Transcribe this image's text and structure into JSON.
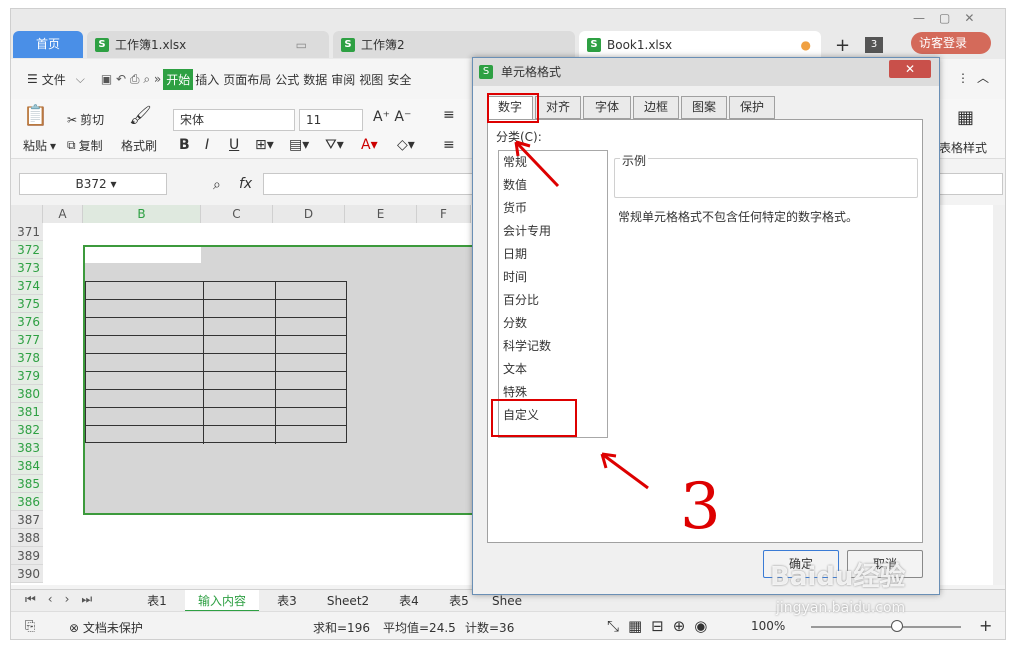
{
  "tabs": {
    "home": "首页",
    "doc1": "工作簿1.xlsx",
    "doc2": "工作簿2",
    "doc3": "Book1.xlsx",
    "count": "3",
    "login": "访客登录"
  },
  "menu": {
    "file": "文件",
    "items": [
      "开始",
      "插入",
      "页面布局",
      "公式",
      "数据",
      "审阅",
      "视图",
      "安全"
    ]
  },
  "ribbon": {
    "paste": "粘贴",
    "cut": "剪切",
    "copy": "复制",
    "format_painter": "格式刷",
    "font": "宋体",
    "size": "11",
    "bold": "B",
    "italic": "I",
    "underline": "U",
    "table_style": "表格样式"
  },
  "formula": {
    "namebox": "B372",
    "fx": "fx"
  },
  "grid": {
    "columns": [
      "A",
      "B",
      "C",
      "D",
      "E",
      "F"
    ],
    "rows": [
      "371",
      "372",
      "373",
      "374",
      "375",
      "376",
      "377",
      "378",
      "379",
      "380",
      "381",
      "382",
      "383",
      "384",
      "385",
      "386",
      "387",
      "388",
      "389",
      "390"
    ]
  },
  "sheets": [
    "表1",
    "输入内容",
    "表3",
    "Sheet2",
    "表4",
    "表5",
    "Shee"
  ],
  "status": {
    "protect": "文档未保护",
    "sum": "求和=196",
    "avg": "平均值=24.5",
    "count": "计数=36",
    "zoom": "100%"
  },
  "dialog": {
    "title": "单元格格式",
    "tabs": [
      "数字",
      "对齐",
      "字体",
      "边框",
      "图案",
      "保护"
    ],
    "category_label": "分类(C):",
    "categories": [
      "常规",
      "数值",
      "货币",
      "会计专用",
      "日期",
      "时间",
      "百分比",
      "分数",
      "科学记数",
      "文本",
      "特殊",
      "自定义"
    ],
    "sample_label": "示例",
    "description": "常规单元格格式不包含任何特定的数字格式。",
    "ok": "确定",
    "cancel": "取消"
  },
  "annotation": {
    "number": "3"
  },
  "watermark": {
    "main": "Baidu经验",
    "sub": "jingyan.baidu.com"
  }
}
